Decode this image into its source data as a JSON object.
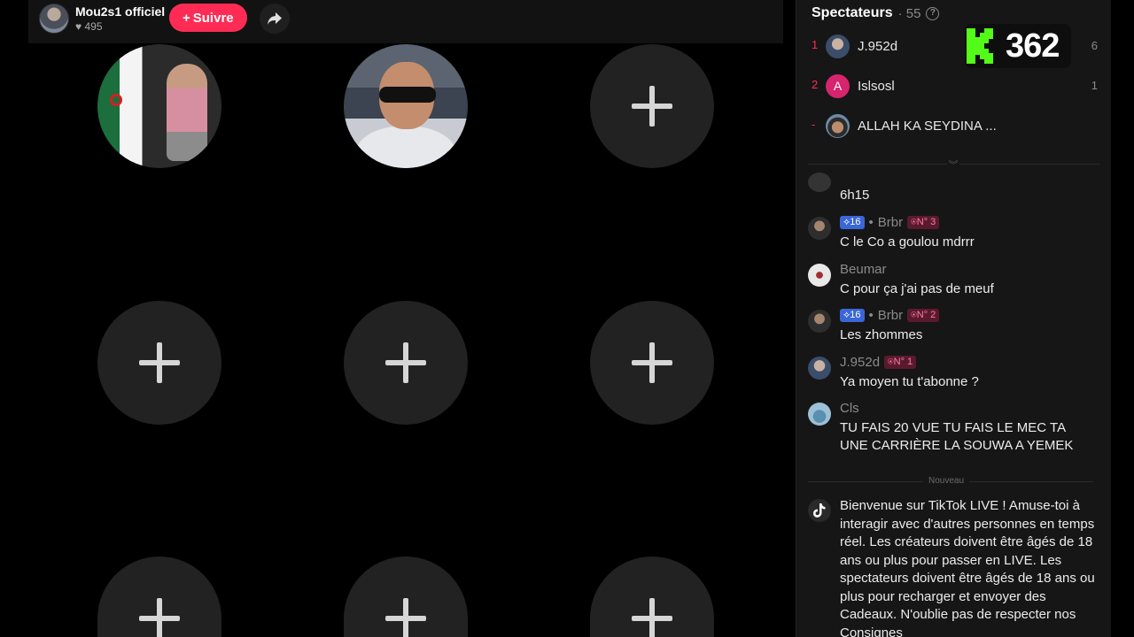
{
  "host": {
    "name": "Mou2s1 officiel",
    "likes": "495",
    "follow_label": "Suivre"
  },
  "viewers": {
    "title": "Spectateurs",
    "count": "· 55",
    "top": [
      {
        "rank": "1",
        "name": "J.952d",
        "score": "6"
      },
      {
        "rank": "2",
        "avatar_letter": "A",
        "name": "Islsosl",
        "score": "1"
      },
      {
        "rank": "-",
        "name": "ALLAH KA SEYDINA ..."
      }
    ]
  },
  "kick_overlay": {
    "score": "362",
    "color": "#53fc18"
  },
  "chat": [
    {
      "user": "",
      "text": "6h15"
    },
    {
      "user": "Brbr",
      "level": "16",
      "rank_badge": "N° 3",
      "text": "C le Co a goulou mdrrr"
    },
    {
      "user": "Beumar",
      "text": "C pour ça j'ai pas de meuf"
    },
    {
      "user": "Brbr",
      "level": "16",
      "rank_badge": "N° 2",
      "text": "Les zhommes"
    },
    {
      "user": "J.952d",
      "rank_badge": "N° 1",
      "text": "Ya moyen tu t'abonne ?"
    },
    {
      "user": "Cls",
      "text": "TU FAIS 20 VUE TU FAIS LE MEC TA UNE CARRIÈRE LA SOUWA A YEMEK"
    }
  ],
  "new_divider": "Nouveau",
  "welcome": "Bienvenue sur TikTok LIVE ! Amuse-toi à interagir avec d'autres personnes en temps réel. Les créateurs doivent être âgés de 18 ans ou plus pour passer en LIVE. Les spectateurs doivent être âgés de 18 ans ou plus pour recharger et envoyer des Cadeaux. N'oublie pas de respecter nos Consignes",
  "colors": {
    "accent": "#fe2c55",
    "level_badge": "#3a67d8",
    "panel_bg": "#161616"
  }
}
